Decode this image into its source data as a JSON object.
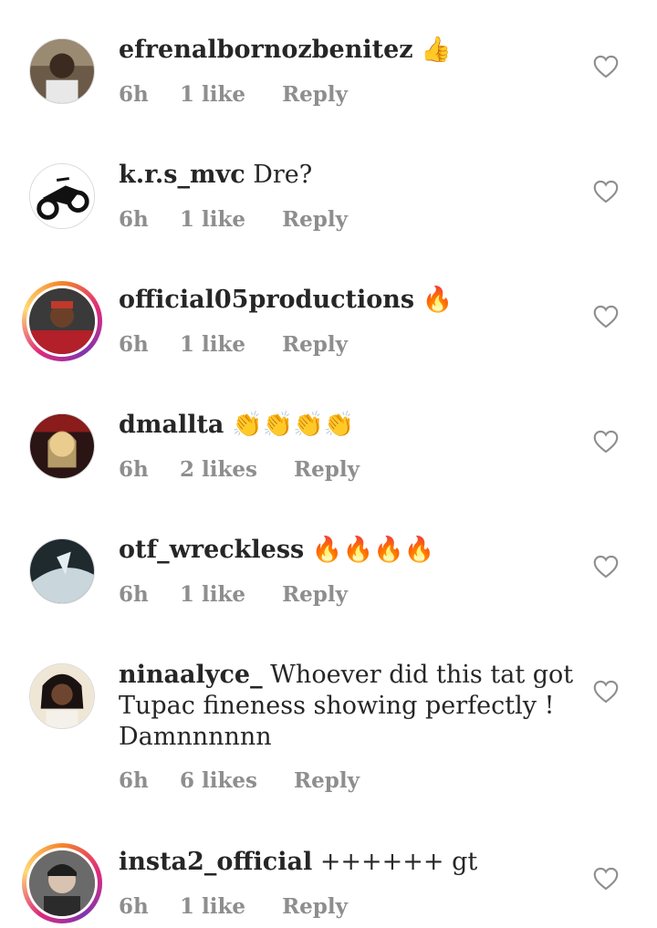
{
  "comments": [
    {
      "username": "efrenalbornozbenitez",
      "text": "👍",
      "time": "6h",
      "likes": "1 like",
      "reply": "Reply"
    },
    {
      "username": "k.r.s_mvc",
      "text": "Dre?",
      "time": "6h",
      "likes": "1 like",
      "reply": "Reply"
    },
    {
      "username": "official05productions",
      "text": "🔥",
      "time": "6h",
      "likes": "1 like",
      "reply": "Reply"
    },
    {
      "username": "dmallta",
      "text": "👏👏👏👏",
      "time": "6h",
      "likes": "2 likes",
      "reply": "Reply"
    },
    {
      "username": "otf_wreckless",
      "text": "🔥🔥🔥🔥",
      "time": "6h",
      "likes": "1 like",
      "reply": "Reply"
    },
    {
      "username": "ninaalyce_",
      "text": "Whoever did this tat got Tupac fineness showing perfectly ! Damnnnnnn",
      "time": "6h",
      "likes": "6 likes",
      "reply": "Reply"
    },
    {
      "username": "insta2_official",
      "text": "++++++ gt",
      "time": "6h",
      "likes": "1 like",
      "reply": "Reply"
    }
  ],
  "icons": {
    "like": "heart-outline-icon"
  },
  "colors": {
    "text": "#262626",
    "meta": "#8e8e8e",
    "heart": "#8e8e8e"
  }
}
